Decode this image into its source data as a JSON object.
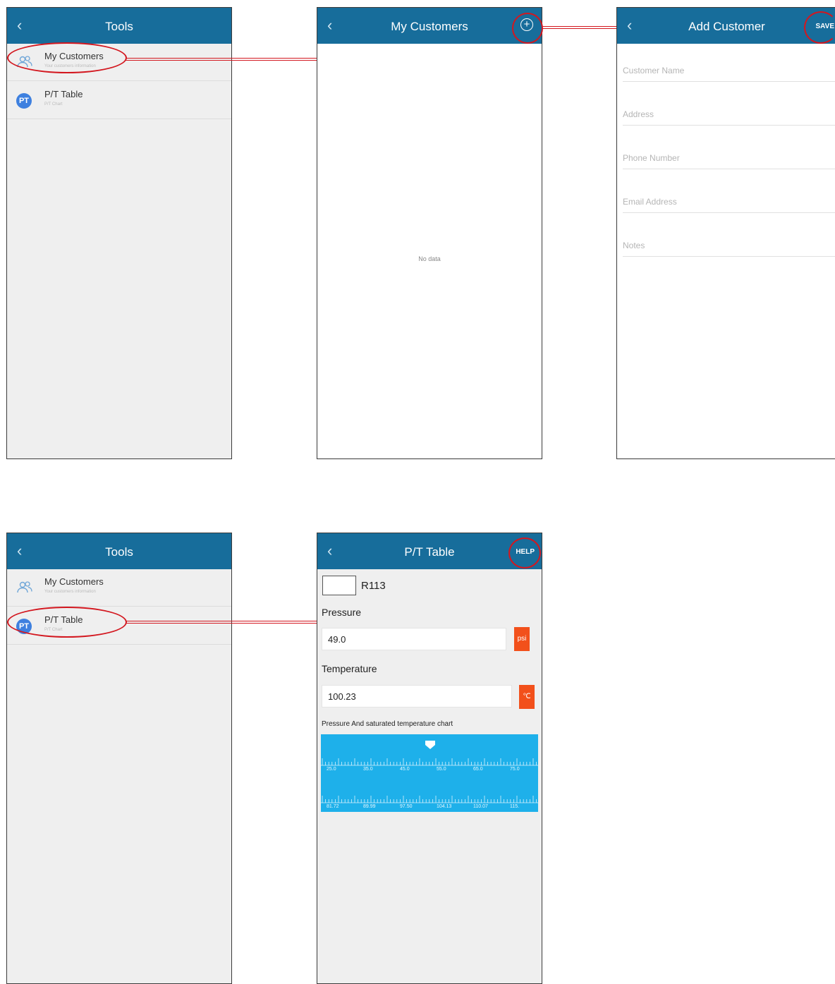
{
  "screens": {
    "tools_top": {
      "title": "Tools",
      "items": [
        {
          "label": "My Customers",
          "subtitle": "Your customers information",
          "icon": "people-icon"
        },
        {
          "label": "P/T Table",
          "subtitle": "P/T Chart",
          "icon": "pt-badge-icon",
          "badge": "PT"
        }
      ]
    },
    "my_customers": {
      "title": "My Customers",
      "empty_text": "No data",
      "add_icon": "plus-circle-icon"
    },
    "add_customer": {
      "title": "Add Customer",
      "save_label": "SAVE",
      "fields": [
        "Customer Name",
        "Address",
        "Phone Number",
        "Email Address",
        "Notes"
      ]
    },
    "tools_bottom": {
      "title": "Tools",
      "items": [
        {
          "label": "My Customers",
          "subtitle": "Your customers information",
          "icon": "people-icon"
        },
        {
          "label": "P/T Table",
          "subtitle": "P/T Chart",
          "icon": "pt-badge-icon",
          "badge": "PT"
        }
      ]
    },
    "pt_table": {
      "title": "P/T Table",
      "help_label": "HELP",
      "refrigerant": "R113",
      "pressure_label": "Pressure",
      "pressure_value": "49.0",
      "pressure_unit": "psi",
      "temperature_label": "Temperature",
      "temperature_value": "100.23",
      "temperature_unit": "℃",
      "chart_title": "Pressure And saturated temperature chart",
      "pressure_ticks": [
        "25.0",
        "35.0",
        "45.0",
        "55.0",
        "65.0",
        "75.0"
      ],
      "temperature_ticks": [
        "81.72",
        "89.99",
        "97.50",
        "104.13",
        "110.07",
        "115."
      ]
    }
  },
  "colors": {
    "app_bar": "#176d9b",
    "callout_red": "#d3171f",
    "unit_button": "#f2501b",
    "scale_panel": "#1eb0ea"
  }
}
